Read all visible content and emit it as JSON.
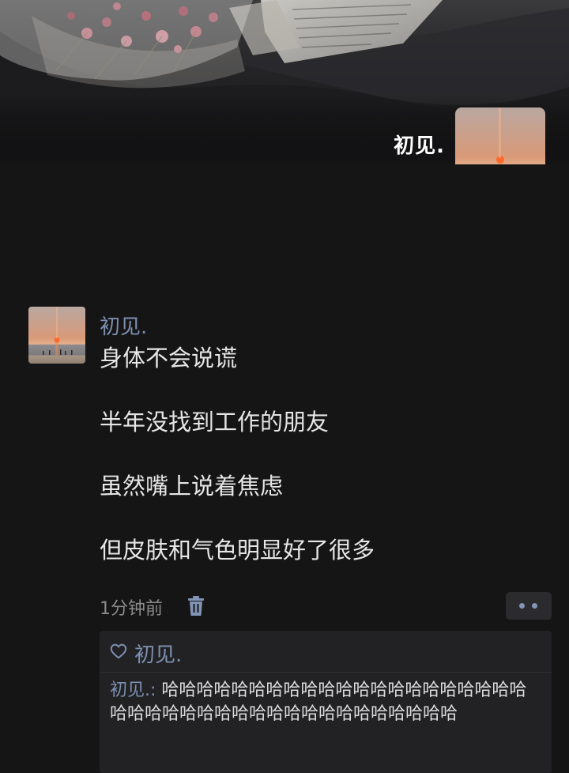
{
  "cover": {
    "username": "初见."
  },
  "post": {
    "author": "初见.",
    "lines": [
      "身体不会说谎",
      "半年没找到工作的朋友",
      "虽然嘴上说着焦虑",
      "但皮肤和气色明显好了很多"
    ],
    "time": "1分钟前"
  },
  "interactions": {
    "likes": [
      "初见."
    ],
    "comments": [
      {
        "author": "初见.",
        "separator": ": ",
        "text": "哈哈哈哈哈哈哈哈哈哈哈哈哈哈哈哈哈哈哈哈哈哈哈哈哈哈哈哈哈哈哈哈哈哈哈哈哈哈哈哈哈"
      }
    ]
  },
  "icons": {
    "like": "heart-outline-icon",
    "delete": "trash-icon",
    "more": "more-dots-icon"
  },
  "colors": {
    "background": "#151515",
    "name_link": "#7d8fb0",
    "body_text": "#e6e6e6",
    "muted_text": "#8a8a8a",
    "panel": "#222224",
    "more_dots": "#8295b6"
  }
}
